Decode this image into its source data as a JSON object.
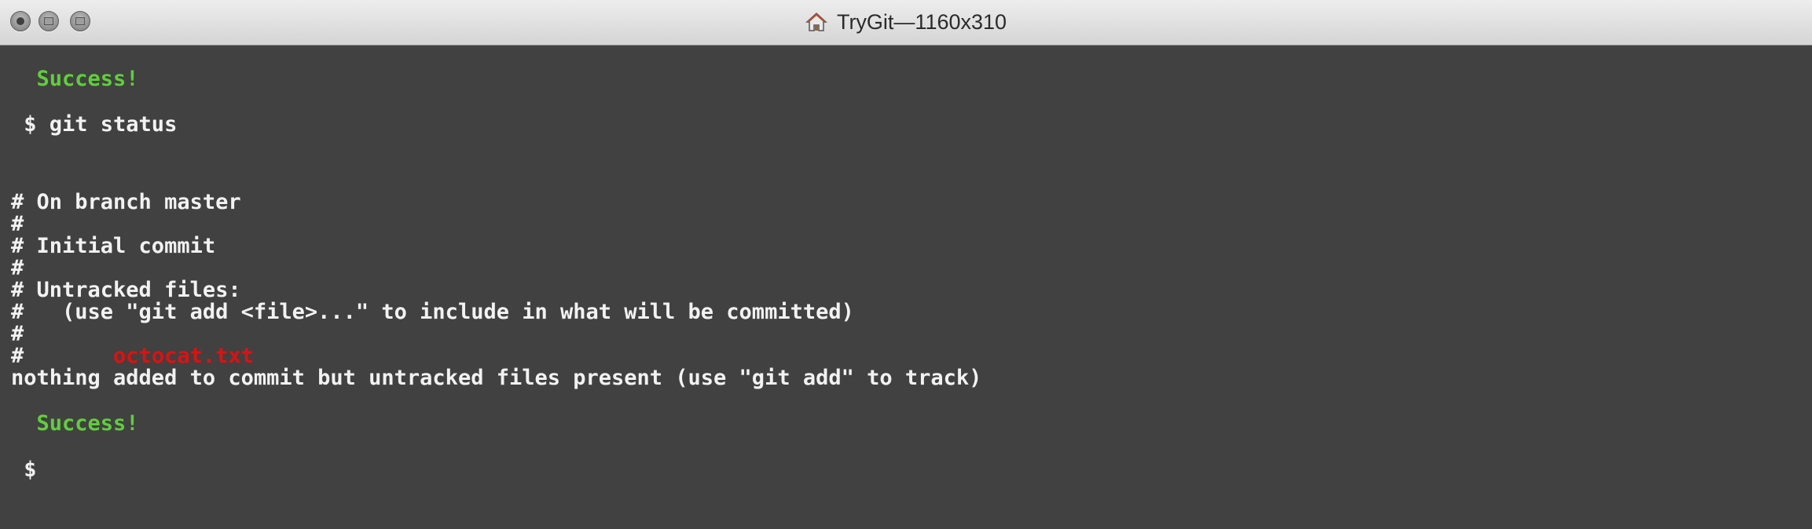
{
  "window": {
    "title": "TryGit—1160x310",
    "icon": "home-icon",
    "buttons": [
      "close-icon",
      "minimize-icon",
      "maximize-icon"
    ]
  },
  "colors": {
    "background": "#414141",
    "text": "#f2f2f2",
    "success": "#5fcf3a",
    "untracked_file": "#e20f0f"
  },
  "terminal": {
    "success_1": "  Success!",
    "command_1": " $ git status",
    "status_lines": [
      "# On branch master",
      "#",
      "# Initial commit",
      "#",
      "# Untracked files:",
      "#   (use \"git add <file>...\" to include in what will be committed)",
      "#"
    ],
    "file_prefix": "#       ",
    "untracked_file": "octocat.txt",
    "nothing_added": "nothing added to commit but untracked files present (use \"git add\" to track)",
    "success_2": "  Success!",
    "prompt": " $"
  }
}
